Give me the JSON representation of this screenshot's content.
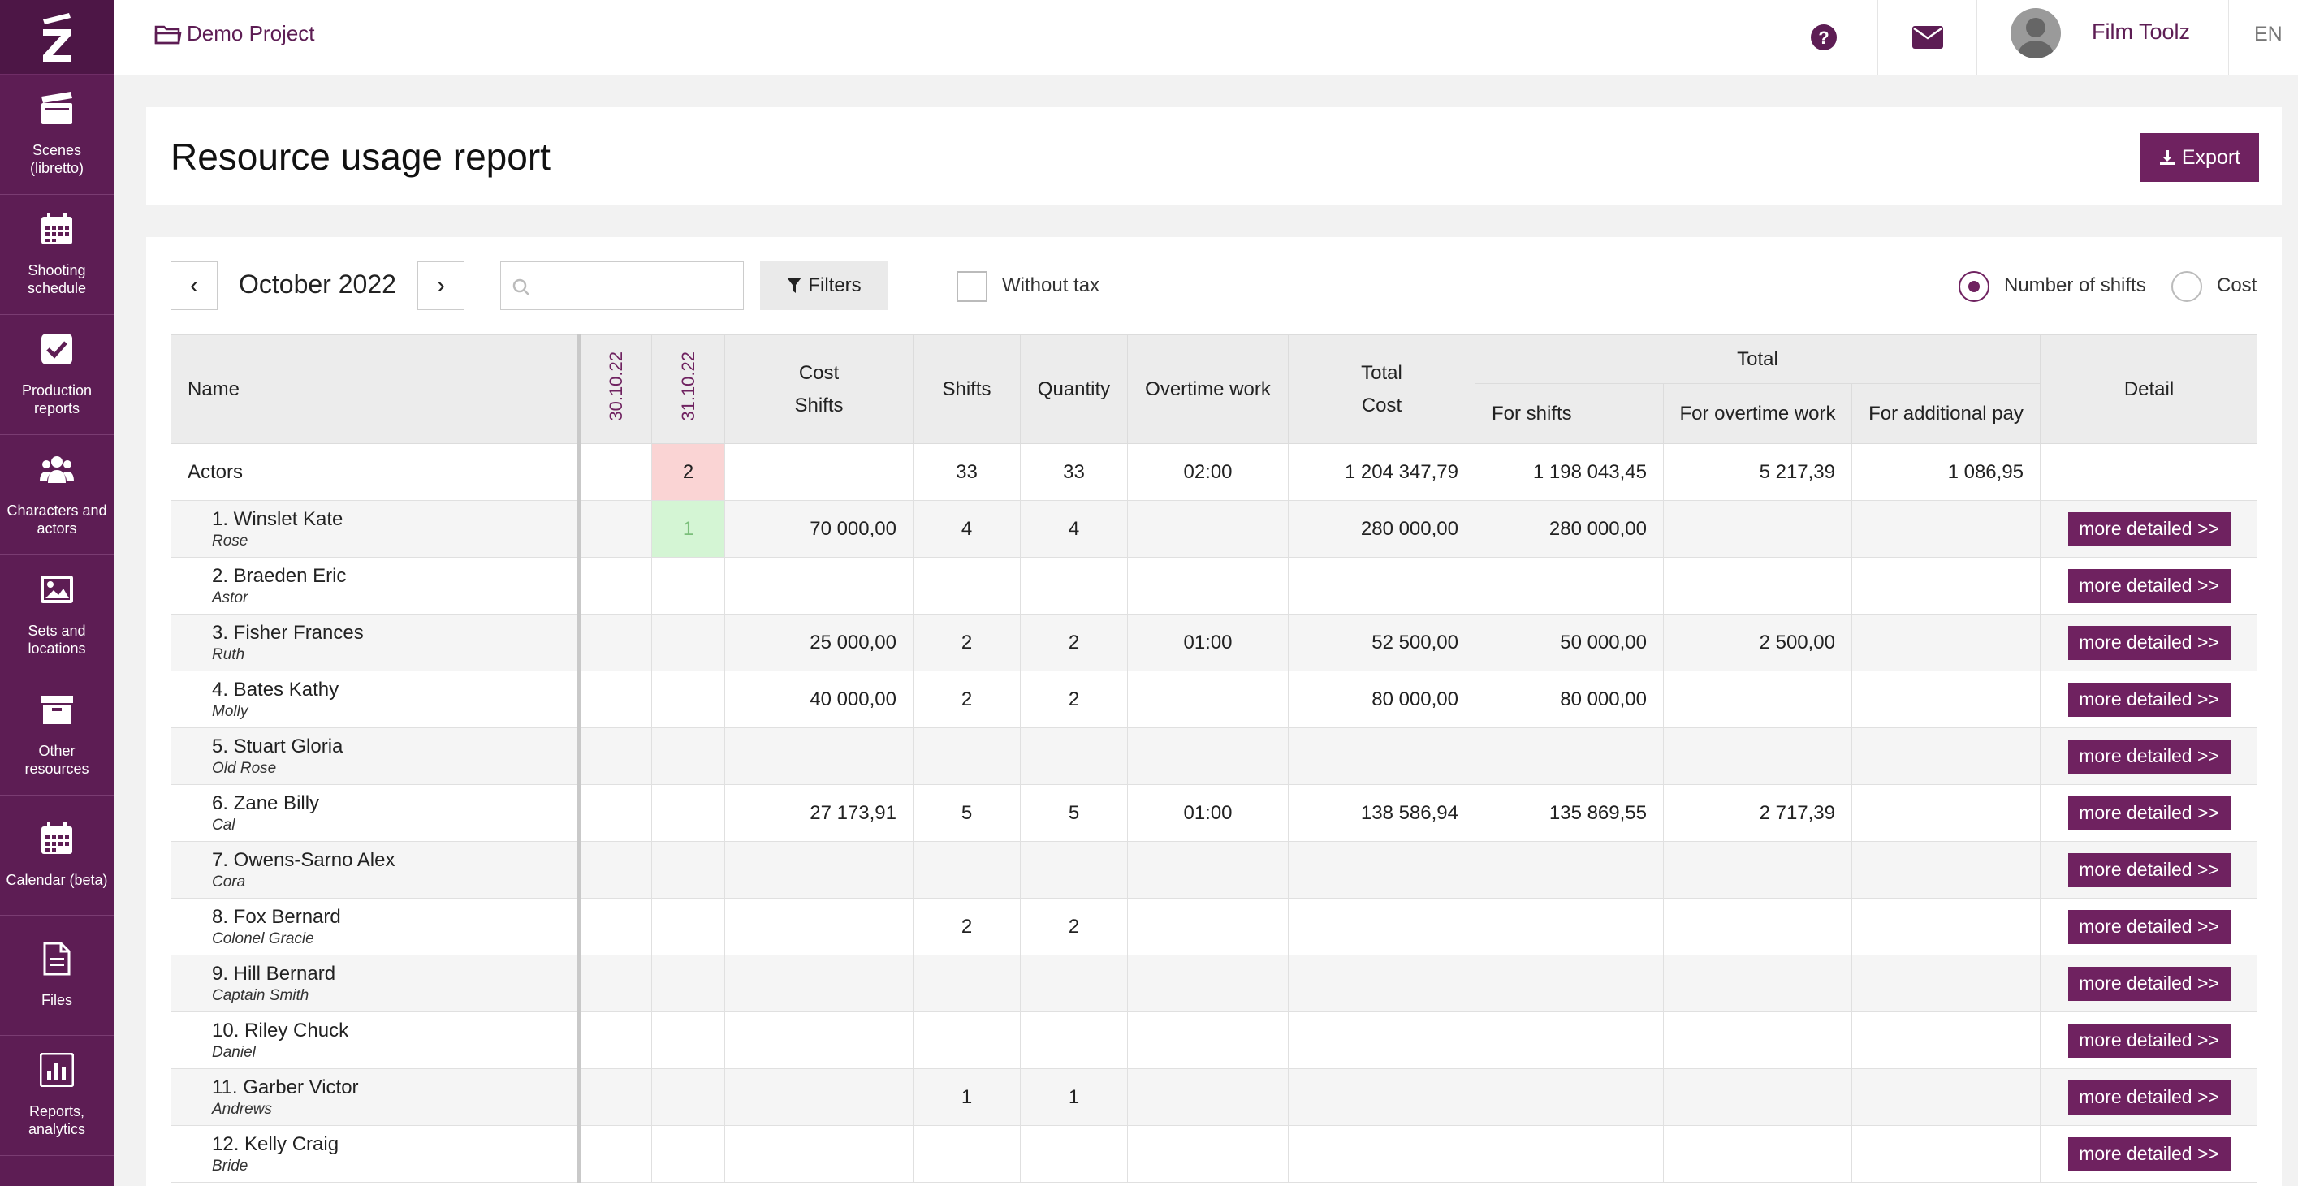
{
  "sidebar": {
    "items": [
      {
        "label": "Scenes (libretto)",
        "icon": "clapperboard-icon"
      },
      {
        "label": "Shooting schedule",
        "icon": "calendar-icon"
      },
      {
        "label": "Production reports",
        "icon": "checkbox-icon"
      },
      {
        "label": "Characters and actors",
        "icon": "users-icon"
      },
      {
        "label": "Sets and locations",
        "icon": "image-icon"
      },
      {
        "label": "Other resources",
        "icon": "archive-icon"
      },
      {
        "label": "Calendar (beta)",
        "icon": "calendar-icon"
      },
      {
        "label": "Files",
        "icon": "file-icon"
      },
      {
        "label": "Reports, analytics",
        "icon": "chart-icon"
      }
    ]
  },
  "topbar": {
    "project": "Demo Project",
    "user": "Film Toolz",
    "lang": "EN"
  },
  "page": {
    "title": "Resource usage report",
    "export_label": "Export"
  },
  "controls": {
    "prev": "‹",
    "next": "›",
    "month": "October 2022",
    "search_value": "",
    "filters_label": "Filters",
    "without_tax_label": "Without tax",
    "radio_shifts_label": "Number of shifts",
    "radio_cost_label": "Cost",
    "radio_selected": "Number of shifts"
  },
  "table": {
    "headers": {
      "name": "Name",
      "date1": "30.10.22",
      "date2": "31.10.22",
      "cost_line1": "Cost",
      "cost_line2": "Shifts",
      "shifts": "Shifts",
      "quantity": "Quantity",
      "overtime": "Overtime work",
      "total_cost_line1": "Total",
      "total_cost_line2": "Cost",
      "total_group": "Total",
      "for_shifts": "For shifts",
      "for_overtime": "For overtime work",
      "for_additional": "For additional pay",
      "detail": "Detail"
    },
    "group_row": {
      "name": "Actors",
      "d1": "",
      "d2": "2",
      "cost": "",
      "shifts": "33",
      "quantity": "33",
      "overtime": "02:00",
      "total_cost": "1 204 347,79",
      "for_shifts": "1 198 043,45",
      "for_overtime": "5 217,39",
      "for_additional": "1 086,95"
    },
    "detail_label": "more detailed >>",
    "rows": [
      {
        "name": "1. Winslet Kate",
        "role": "Rose",
        "d1": "",
        "d2": "1",
        "cost": "70 000,00",
        "shifts": "4",
        "quantity": "4",
        "overtime": "",
        "total_cost": "280 000,00",
        "for_shifts": "280 000,00",
        "for_overtime": "",
        "for_additional": ""
      },
      {
        "name": "2. Braeden Eric",
        "role": "Astor",
        "d1": "",
        "d2": "",
        "cost": "",
        "shifts": "",
        "quantity": "",
        "overtime": "",
        "total_cost": "",
        "for_shifts": "",
        "for_overtime": "",
        "for_additional": ""
      },
      {
        "name": "3. Fisher Frances",
        "role": "Ruth",
        "d1": "",
        "d2": "",
        "cost": "25 000,00",
        "shifts": "2",
        "quantity": "2",
        "overtime": "01:00",
        "total_cost": "52 500,00",
        "for_shifts": "50 000,00",
        "for_overtime": "2 500,00",
        "for_additional": ""
      },
      {
        "name": "4. Bates Kathy",
        "role": "Molly",
        "d1": "",
        "d2": "",
        "cost": "40 000,00",
        "shifts": "2",
        "quantity": "2",
        "overtime": "",
        "total_cost": "80 000,00",
        "for_shifts": "80 000,00",
        "for_overtime": "",
        "for_additional": ""
      },
      {
        "name": "5. Stuart Gloria",
        "role": "Old Rose",
        "d1": "",
        "d2": "",
        "cost": "",
        "shifts": "",
        "quantity": "",
        "overtime": "",
        "total_cost": "",
        "for_shifts": "",
        "for_overtime": "",
        "for_additional": ""
      },
      {
        "name": "6. Zane Billy",
        "role": "Cal",
        "d1": "",
        "d2": "",
        "cost": "27 173,91",
        "shifts": "5",
        "quantity": "5",
        "overtime": "01:00",
        "total_cost": "138 586,94",
        "for_shifts": "135 869,55",
        "for_overtime": "2 717,39",
        "for_additional": ""
      },
      {
        "name": "7. Owens-Sarno Alex",
        "role": "Cora",
        "d1": "",
        "d2": "",
        "cost": "",
        "shifts": "",
        "quantity": "",
        "overtime": "",
        "total_cost": "",
        "for_shifts": "",
        "for_overtime": "",
        "for_additional": ""
      },
      {
        "name": "8. Fox Bernard",
        "role": "Colonel Gracie",
        "d1": "",
        "d2": "",
        "cost": "",
        "shifts": "2",
        "quantity": "2",
        "overtime": "",
        "total_cost": "",
        "for_shifts": "",
        "for_overtime": "",
        "for_additional": ""
      },
      {
        "name": "9. Hill Bernard",
        "role": "Captain Smith",
        "d1": "",
        "d2": "",
        "cost": "",
        "shifts": "",
        "quantity": "",
        "overtime": "",
        "total_cost": "",
        "for_shifts": "",
        "for_overtime": "",
        "for_additional": ""
      },
      {
        "name": "10. Riley Chuck",
        "role": "Daniel",
        "d1": "",
        "d2": "",
        "cost": "",
        "shifts": "",
        "quantity": "",
        "overtime": "",
        "total_cost": "",
        "for_shifts": "",
        "for_overtime": "",
        "for_additional": ""
      },
      {
        "name": "11. Garber Victor",
        "role": "Andrews",
        "d1": "",
        "d2": "",
        "cost": "",
        "shifts": "1",
        "quantity": "1",
        "overtime": "",
        "total_cost": "",
        "for_shifts": "",
        "for_overtime": "",
        "for_additional": ""
      },
      {
        "name": "12. Kelly Craig",
        "role": "Bride",
        "d1": "",
        "d2": "",
        "cost": "",
        "shifts": "",
        "quantity": "",
        "overtime": "",
        "total_cost": "",
        "for_shifts": "",
        "for_overtime": "",
        "for_additional": ""
      }
    ]
  },
  "colors": {
    "sidebar": "#5d1d54",
    "accent": "#6f2260",
    "highlight_red": "#fad4d4",
    "highlight_green": "#d4f5d4"
  }
}
